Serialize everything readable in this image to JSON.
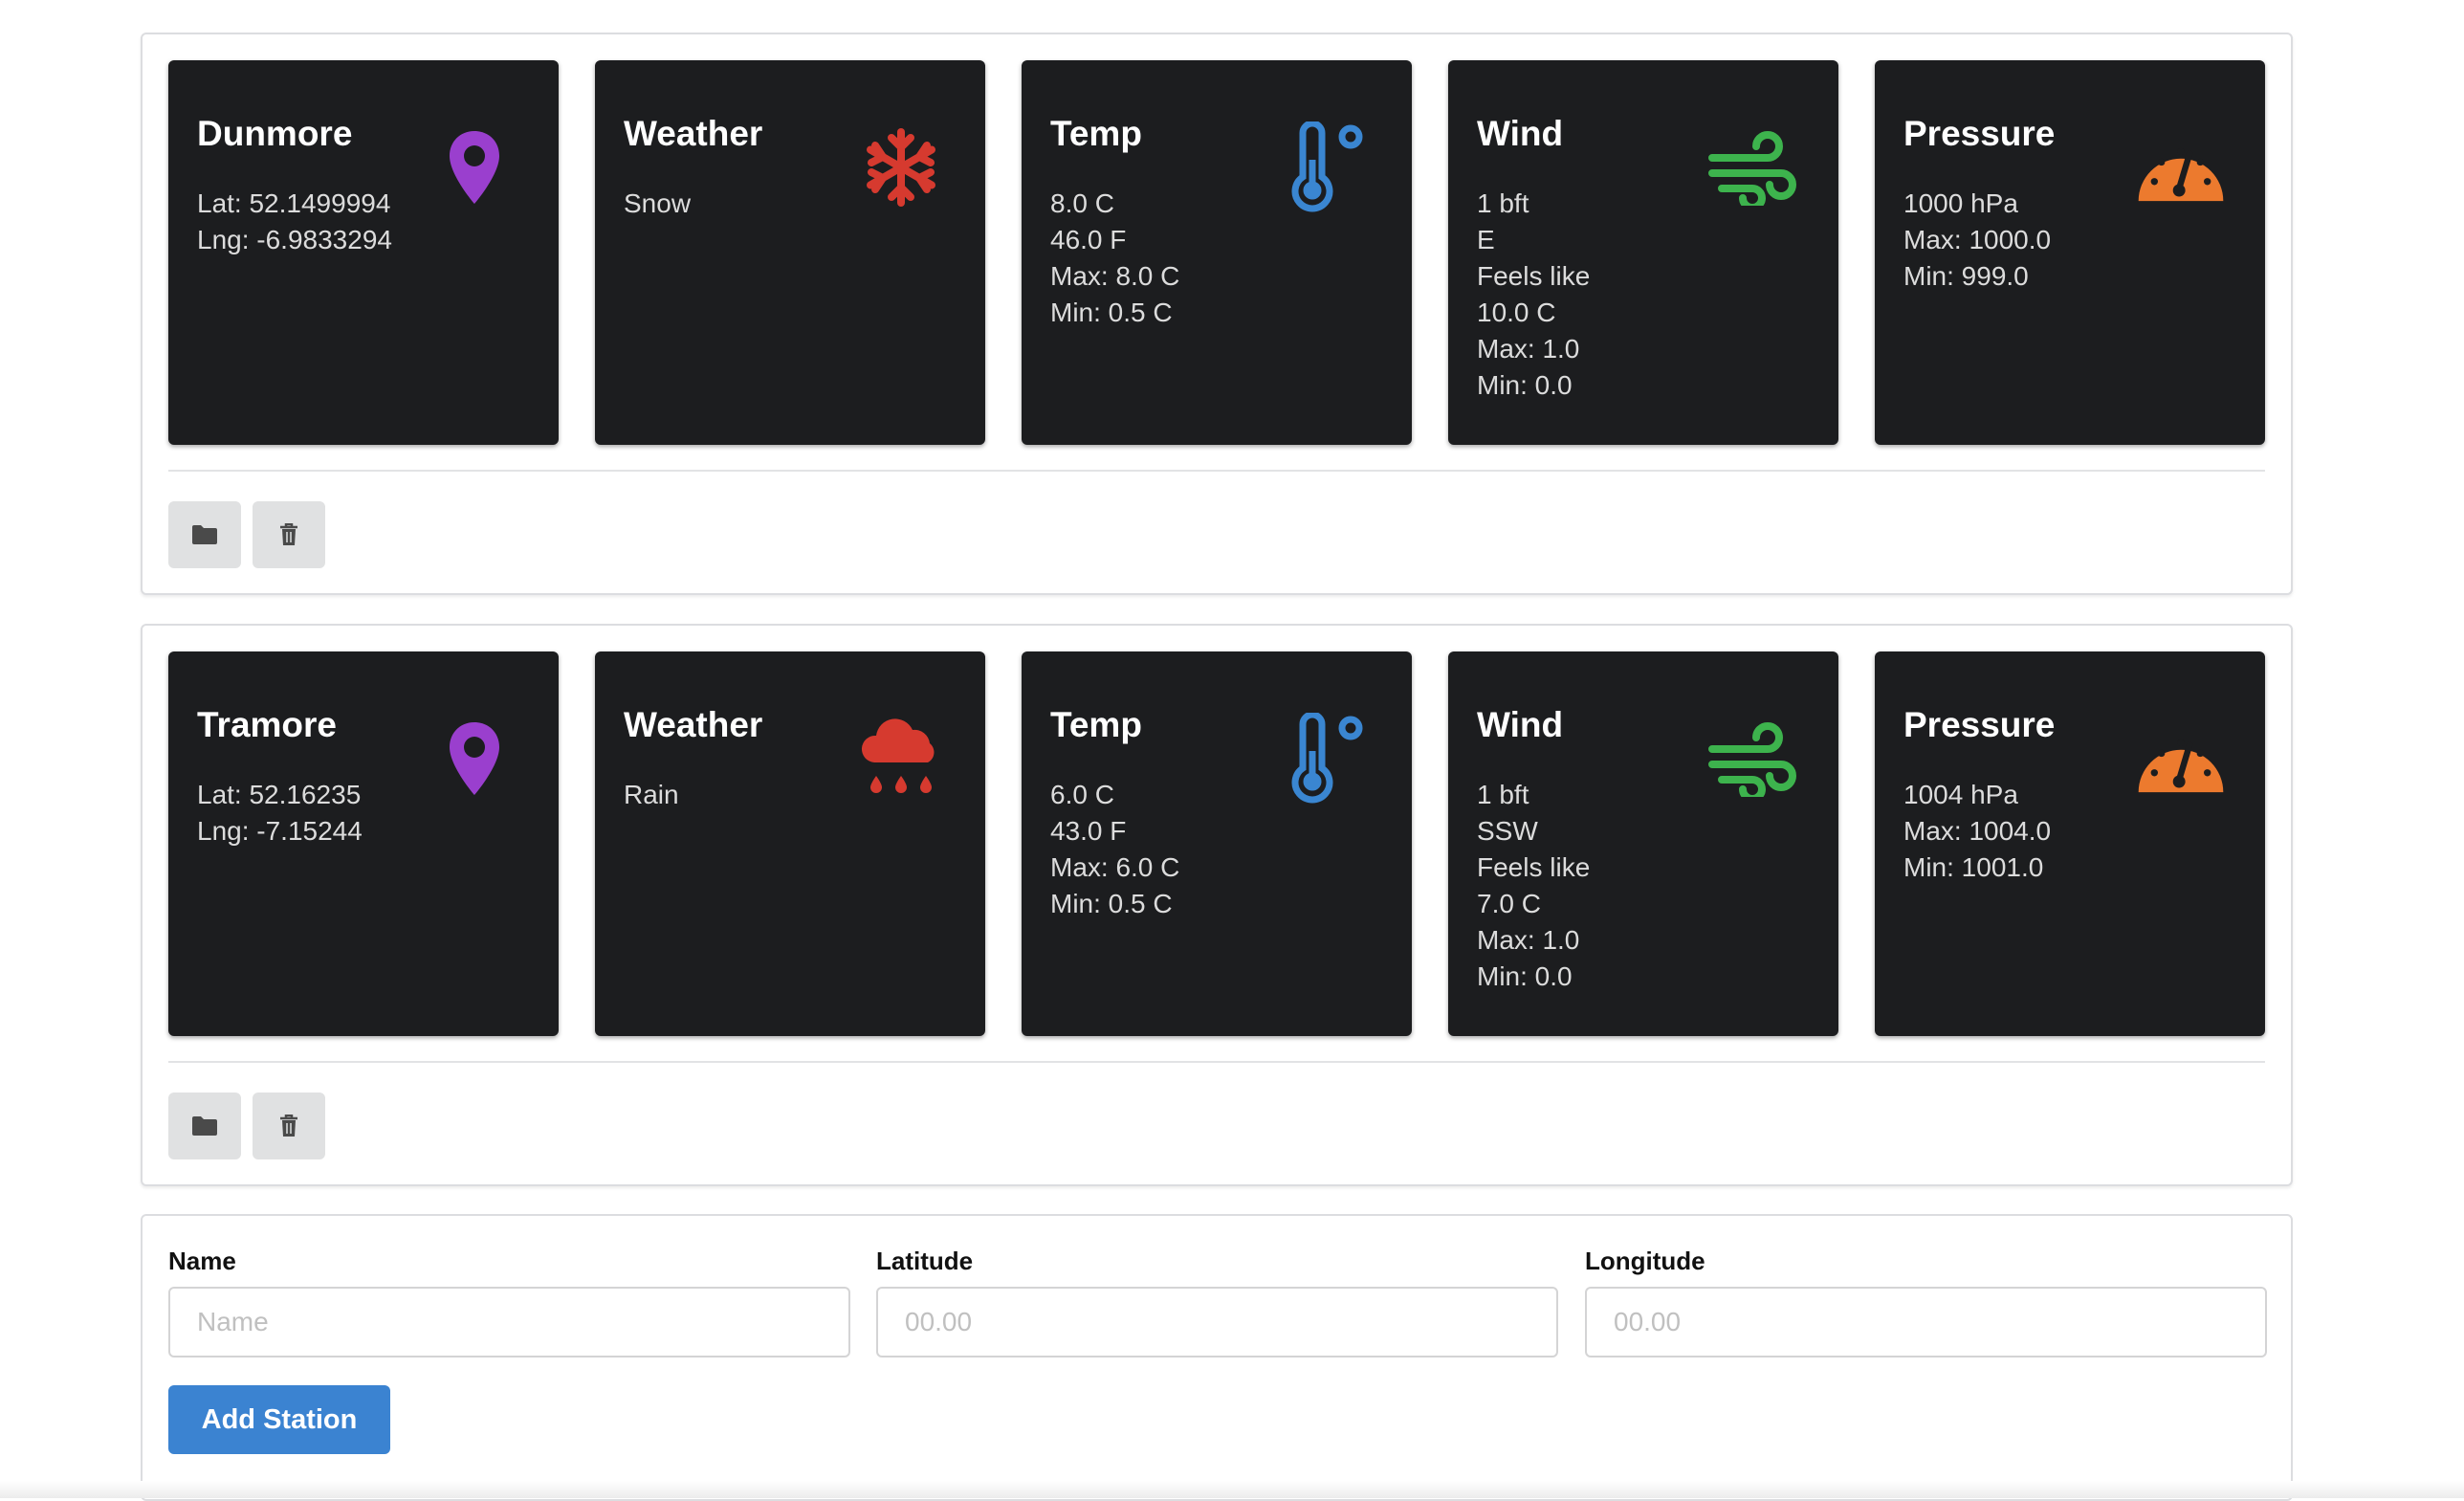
{
  "stations": [
    {
      "name": "Dunmore",
      "lat_line": "Lat: 52.1499994",
      "lng_line": "Lng: -6.9833294",
      "weather_title": "Weather",
      "weather": "Snow",
      "weather_icon": "snowflake-icon",
      "temp_title": "Temp",
      "temp_lines": [
        "8.0 C",
        "46.0 F",
        "Max: 8.0 C",
        "Min: 0.5 C"
      ],
      "wind_title": "Wind",
      "wind_lines": [
        "1 bft",
        "E",
        "Feels like",
        "10.0 C",
        "Max: 1.0",
        "Min: 0.0"
      ],
      "pressure_title": "Pressure",
      "pressure_lines": [
        "1000 hPa",
        "Max: 1000.0",
        "Min: 999.0"
      ]
    },
    {
      "name": "Tramore",
      "lat_line": "Lat: 52.16235",
      "lng_line": "Lng: -7.15244",
      "weather_title": "Weather",
      "weather": "Rain",
      "weather_icon": "rain-cloud-icon",
      "temp_title": "Temp",
      "temp_lines": [
        "6.0 C",
        "43.0 F",
        "Max: 6.0 C",
        "Min: 0.5 C"
      ],
      "wind_title": "Wind",
      "wind_lines": [
        "1 bft",
        "SSW",
        "Feels like",
        "7.0 C",
        "Max: 1.0",
        "Min: 0.0"
      ],
      "pressure_title": "Pressure",
      "pressure_lines": [
        "1004 hPa",
        "Max: 1004.0",
        "Min: 1001.0"
      ]
    }
  ],
  "form": {
    "name_label": "Name",
    "name_placeholder": "Name",
    "name_value": "",
    "latitude_label": "Latitude",
    "latitude_placeholder": "00.00",
    "latitude_value": "",
    "longitude_label": "Longitude",
    "longitude_placeholder": "00.00",
    "longitude_value": "",
    "submit_label": "Add Station"
  },
  "colors": {
    "card_bg": "#1c1d1f",
    "location": "#9a3fce",
    "weather": "#d63a2f",
    "temp": "#3a86d1",
    "wind": "#3db34d",
    "pressure": "#ec7a2e",
    "primary_button": "#3b83d1"
  },
  "icons": {
    "location": "map-marker-icon",
    "temp": "thermometer-icon",
    "wind": "wind-icon",
    "pressure": "gauge-icon",
    "open": "folder-icon",
    "delete": "trash-icon"
  }
}
